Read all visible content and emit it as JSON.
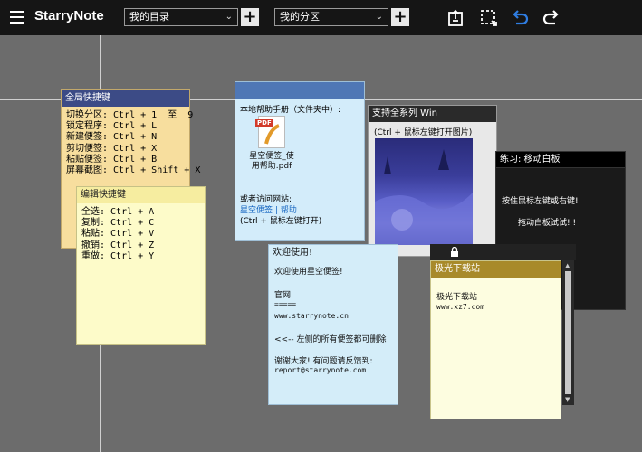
{
  "app": {
    "brand": "StarryNote"
  },
  "toolbar": {
    "directory_select": "我的目录",
    "section_select": "我的分区",
    "add_label": "+"
  },
  "notes": {
    "global": {
      "title": "全局快捷键",
      "lines": [
        "切换分区: Ctrl + 1  至  9",
        "锁定程序: Ctrl + L",
        "新建便签: Ctrl + N",
        "剪切便签: Ctrl + X",
        "粘贴便签: Ctrl + B",
        "屏幕截图: Ctrl + Shift + X"
      ]
    },
    "edit": {
      "title": "编辑快捷键",
      "lines": [
        "全选: Ctrl + A",
        "复制: Ctrl + C",
        "粘贴: Ctrl + V",
        "撤销: Ctrl + Z",
        "重做: Ctrl + Y"
      ]
    },
    "help": {
      "line1": "本地帮助手册（文件夹中）:",
      "file_name": "星空便签_使用帮助.pdf",
      "pdf_badge": "PDF",
      "line2": "或者访问网站:",
      "link1": "星空便签",
      "sep": "|",
      "link2": "帮助",
      "line3": "(Ctrl + 鼠标左键打开)"
    },
    "win": {
      "title": "支持全系列 Win",
      "sub": "(Ctrl + 鼠标左键打开图片)"
    },
    "move": {
      "title": "练习: 移动白板",
      "line1": "按住鼠标左键或右键!",
      "line2": "拖动白板试试! !"
    },
    "welcome": {
      "title": "欢迎使用!",
      "l1": "欢迎使用星空便签!",
      "l2": "官网:",
      "l3": "=====",
      "l4": "www.starrynote.cn",
      "l5": "<<-- 左侧的所有便签都可删除",
      "l6": "谢谢大家! 有问题请反馈到:",
      "l7": "report@starrynote.com"
    },
    "aurora": {
      "title": "极光下载站",
      "l1": "极光下载站",
      "l2": "www.xz7.com"
    }
  },
  "icons": {
    "menu": "hamburger-icon",
    "export": "export-icon",
    "screenshot": "crop-select-icon",
    "undo": "undo-icon",
    "redo": "redo-icon",
    "lock": "lock-icon"
  },
  "colors": {
    "accent_blue": "#2f7de1",
    "link": "#1565c0"
  }
}
